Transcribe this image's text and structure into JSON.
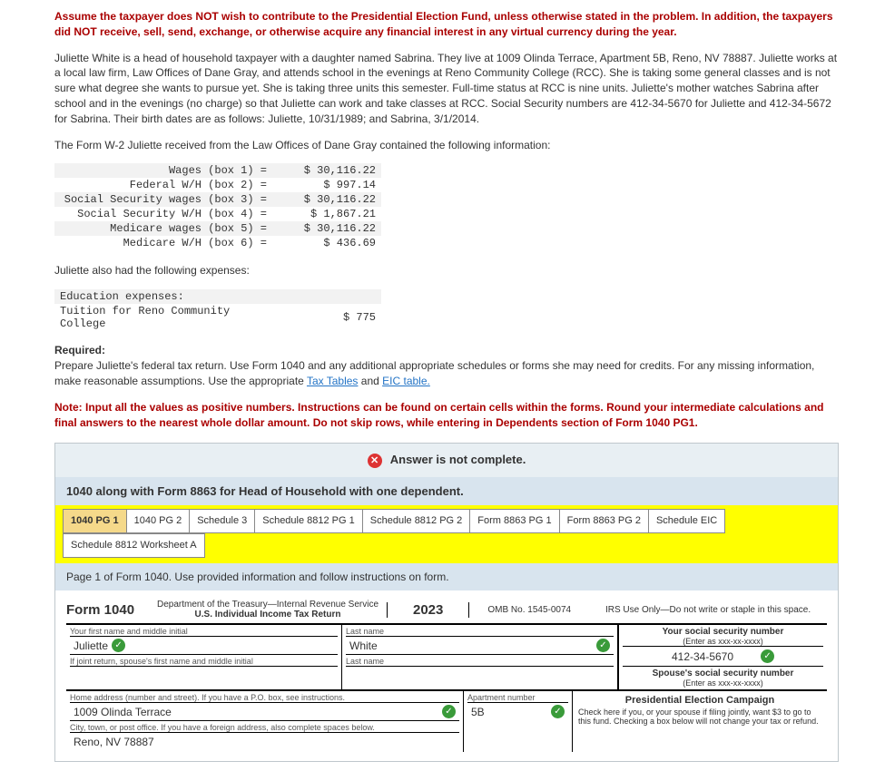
{
  "intro_warning": "Assume the taxpayer does NOT wish to contribute to the Presidential Election Fund, unless otherwise stated in the problem. In addition, the taxpayers did NOT receive, sell, send, exchange, or otherwise acquire any financial interest in any virtual currency during the year.",
  "scenario": "Juliette White is a head of household taxpayer with a daughter named Sabrina. They live at 1009 Olinda Terrace, Apartment 5B, Reno, NV 78887. Juliette works at a local law firm, Law Offices of Dane Gray, and attends school in the evenings at Reno Community College (RCC). She is taking some general classes and is not sure what degree she wants to pursue yet. She is taking three units this semester. Full-time status at RCC is nine units. Juliette's mother watches Sabrina after school and in the evenings (no charge) so that Juliette can work and take classes at RCC. Social Security numbers are 412-34-5670 for Juliette and 412-34-5672 for Sabrina. Their birth dates are as follows: Juliette, 10/31/1989; and Sabrina, 3/1/2014.",
  "w2_intro": "The Form W-2 Juliette received from the Law Offices of Dane Gray contained the following information:",
  "w2": [
    {
      "label": "Wages (box 1) =",
      "val": "$ 30,116.22"
    },
    {
      "label": "Federal W/H (box 2) =",
      "val": "$ 997.14"
    },
    {
      "label": "Social Security wages (box 3) =",
      "val": "$ 30,116.22"
    },
    {
      "label": "Social Security W/H (box 4) =",
      "val": "$ 1,867.21"
    },
    {
      "label": "Medicare wages (box 5) =",
      "val": "$ 30,116.22"
    },
    {
      "label": "Medicare W/H (box 6) =",
      "val": "$ 436.69"
    }
  ],
  "exp_intro": "Juliette also had the following expenses:",
  "expenses": [
    {
      "label": "Education expenses:",
      "val": ""
    },
    {
      "label": "Tuition for Reno Community College",
      "val": "$ 775"
    }
  ],
  "required_label": "Required:",
  "required_text": "Prepare Juliette's federal tax return. Use Form 1040 and any additional appropriate schedules or forms she may need for credits. For any missing information, make reasonable assumptions. Use the appropriate ",
  "link_tax": "Tax Tables",
  "and_word": " and ",
  "link_eic": "EIC table.",
  "note": "Note: Input all the values as positive numbers. Instructions can be found on certain cells within the forms. Round your intermediate calculations and final answers to the nearest whole dollar amount. Do not skip rows, while entering in Dependents section of Form 1040 PG1.",
  "answer_status": "Answer is not complete.",
  "form_desc": "1040 along with Form 8863 for Head of Household with one dependent.",
  "tabs": {
    "t1": "1040 PG 1",
    "t2": "1040 PG 2",
    "t3": "Schedule 3",
    "t4": "Schedule 8812 PG 1",
    "t5": "Schedule 8812 PG 2",
    "t6": "Form 8863 PG 1",
    "t7": "Form 8863 PG 2",
    "t8": "Schedule EIC",
    "t9": "Schedule 8812 Worksheet A"
  },
  "page_instr": "Page 1 of Form 1040. Use provided information and follow instructions on form.",
  "form": {
    "title": "Form 1040",
    "dept1": "Department of the Treasury—Internal Revenue Service",
    "dept2": "U.S. Individual Income Tax Return",
    "year": "2023",
    "omb": "OMB No. 1545-0074",
    "irs": "IRS Use Only—Do not write or staple in this space.",
    "first_lbl": "Your first name and middle initial",
    "last_lbl": "Last name",
    "first_val": "Juliette",
    "last_val": "White",
    "spouse_first_lbl": "If joint return, spouse's first name and middle initial",
    "spouse_last_lbl": "Last name",
    "ssn_t": "Your social security number",
    "ssn_s": "(Enter as xxx-xx-xxxx)",
    "ssn_val": "412-34-5670",
    "sp_ssn_t": "Spouse's social security number",
    "sp_ssn_s": "(Enter as xxx-xx-xxxx)",
    "addr_lbl": "Home address (number and street). If you have a P.O. box, see instructions.",
    "addr_val": "1009 Olinda Terrace",
    "apt_lbl": "Apartment number",
    "apt_val": "5B",
    "city_lbl": "City, town, or post office. If you have a foreign address, also complete spaces below.",
    "city_val": "Reno, NV 78887",
    "pres_t": "Presidential Election Campaign",
    "pres_txt": "Check here if you, or your spouse if filing jointly, want $3 to go to this fund. Checking a box below will not change your tax or refund."
  }
}
